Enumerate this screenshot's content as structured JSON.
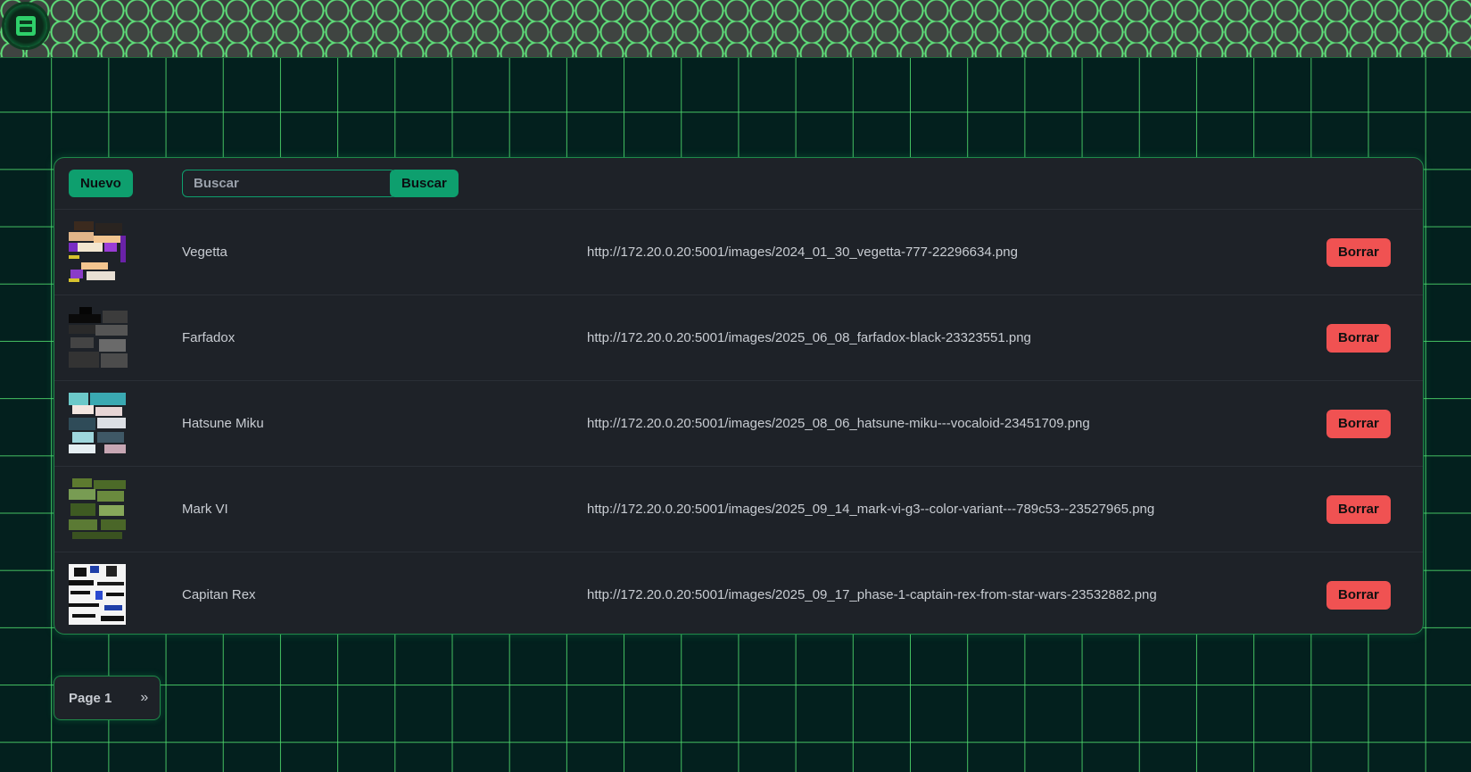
{
  "header": {
    "logo_icon": "creeper-logo-icon"
  },
  "toolbar": {
    "new_label": "Nuevo",
    "search_placeholder": "Buscar",
    "search_label": "Buscar"
  },
  "rows": [
    {
      "name": "Vegetta",
      "url": "http://172.20.0.20:5001/images/2024_01_30_vegetta-777-22296634.png",
      "delete_label": "Borrar"
    },
    {
      "name": "Farfadox",
      "url": "http://172.20.0.20:5001/images/2025_06_08_farfadox-black-23323551.png",
      "delete_label": "Borrar"
    },
    {
      "name": "Hatsune Miku",
      "url": "http://172.20.0.20:5001/images/2025_08_06_hatsune-miku---vocaloid-23451709.png",
      "delete_label": "Borrar"
    },
    {
      "name": "Mark VI",
      "url": "http://172.20.0.20:5001/images/2025_09_14_mark-vi-g3--color-variant---789c53--23527965.png",
      "delete_label": "Borrar"
    },
    {
      "name": "Capitan Rex",
      "url": "http://172.20.0.20:5001/images/2025_09_17_phase-1-captain-rex-from-star-wars-23532882.png",
      "delete_label": "Borrar"
    }
  ],
  "pagination": {
    "label": "Page 1",
    "next": "»"
  },
  "colors": {
    "accent": "#0e9f6e",
    "danger": "#f05252",
    "panel": "#1e2228",
    "grid": "#50dc6e"
  }
}
